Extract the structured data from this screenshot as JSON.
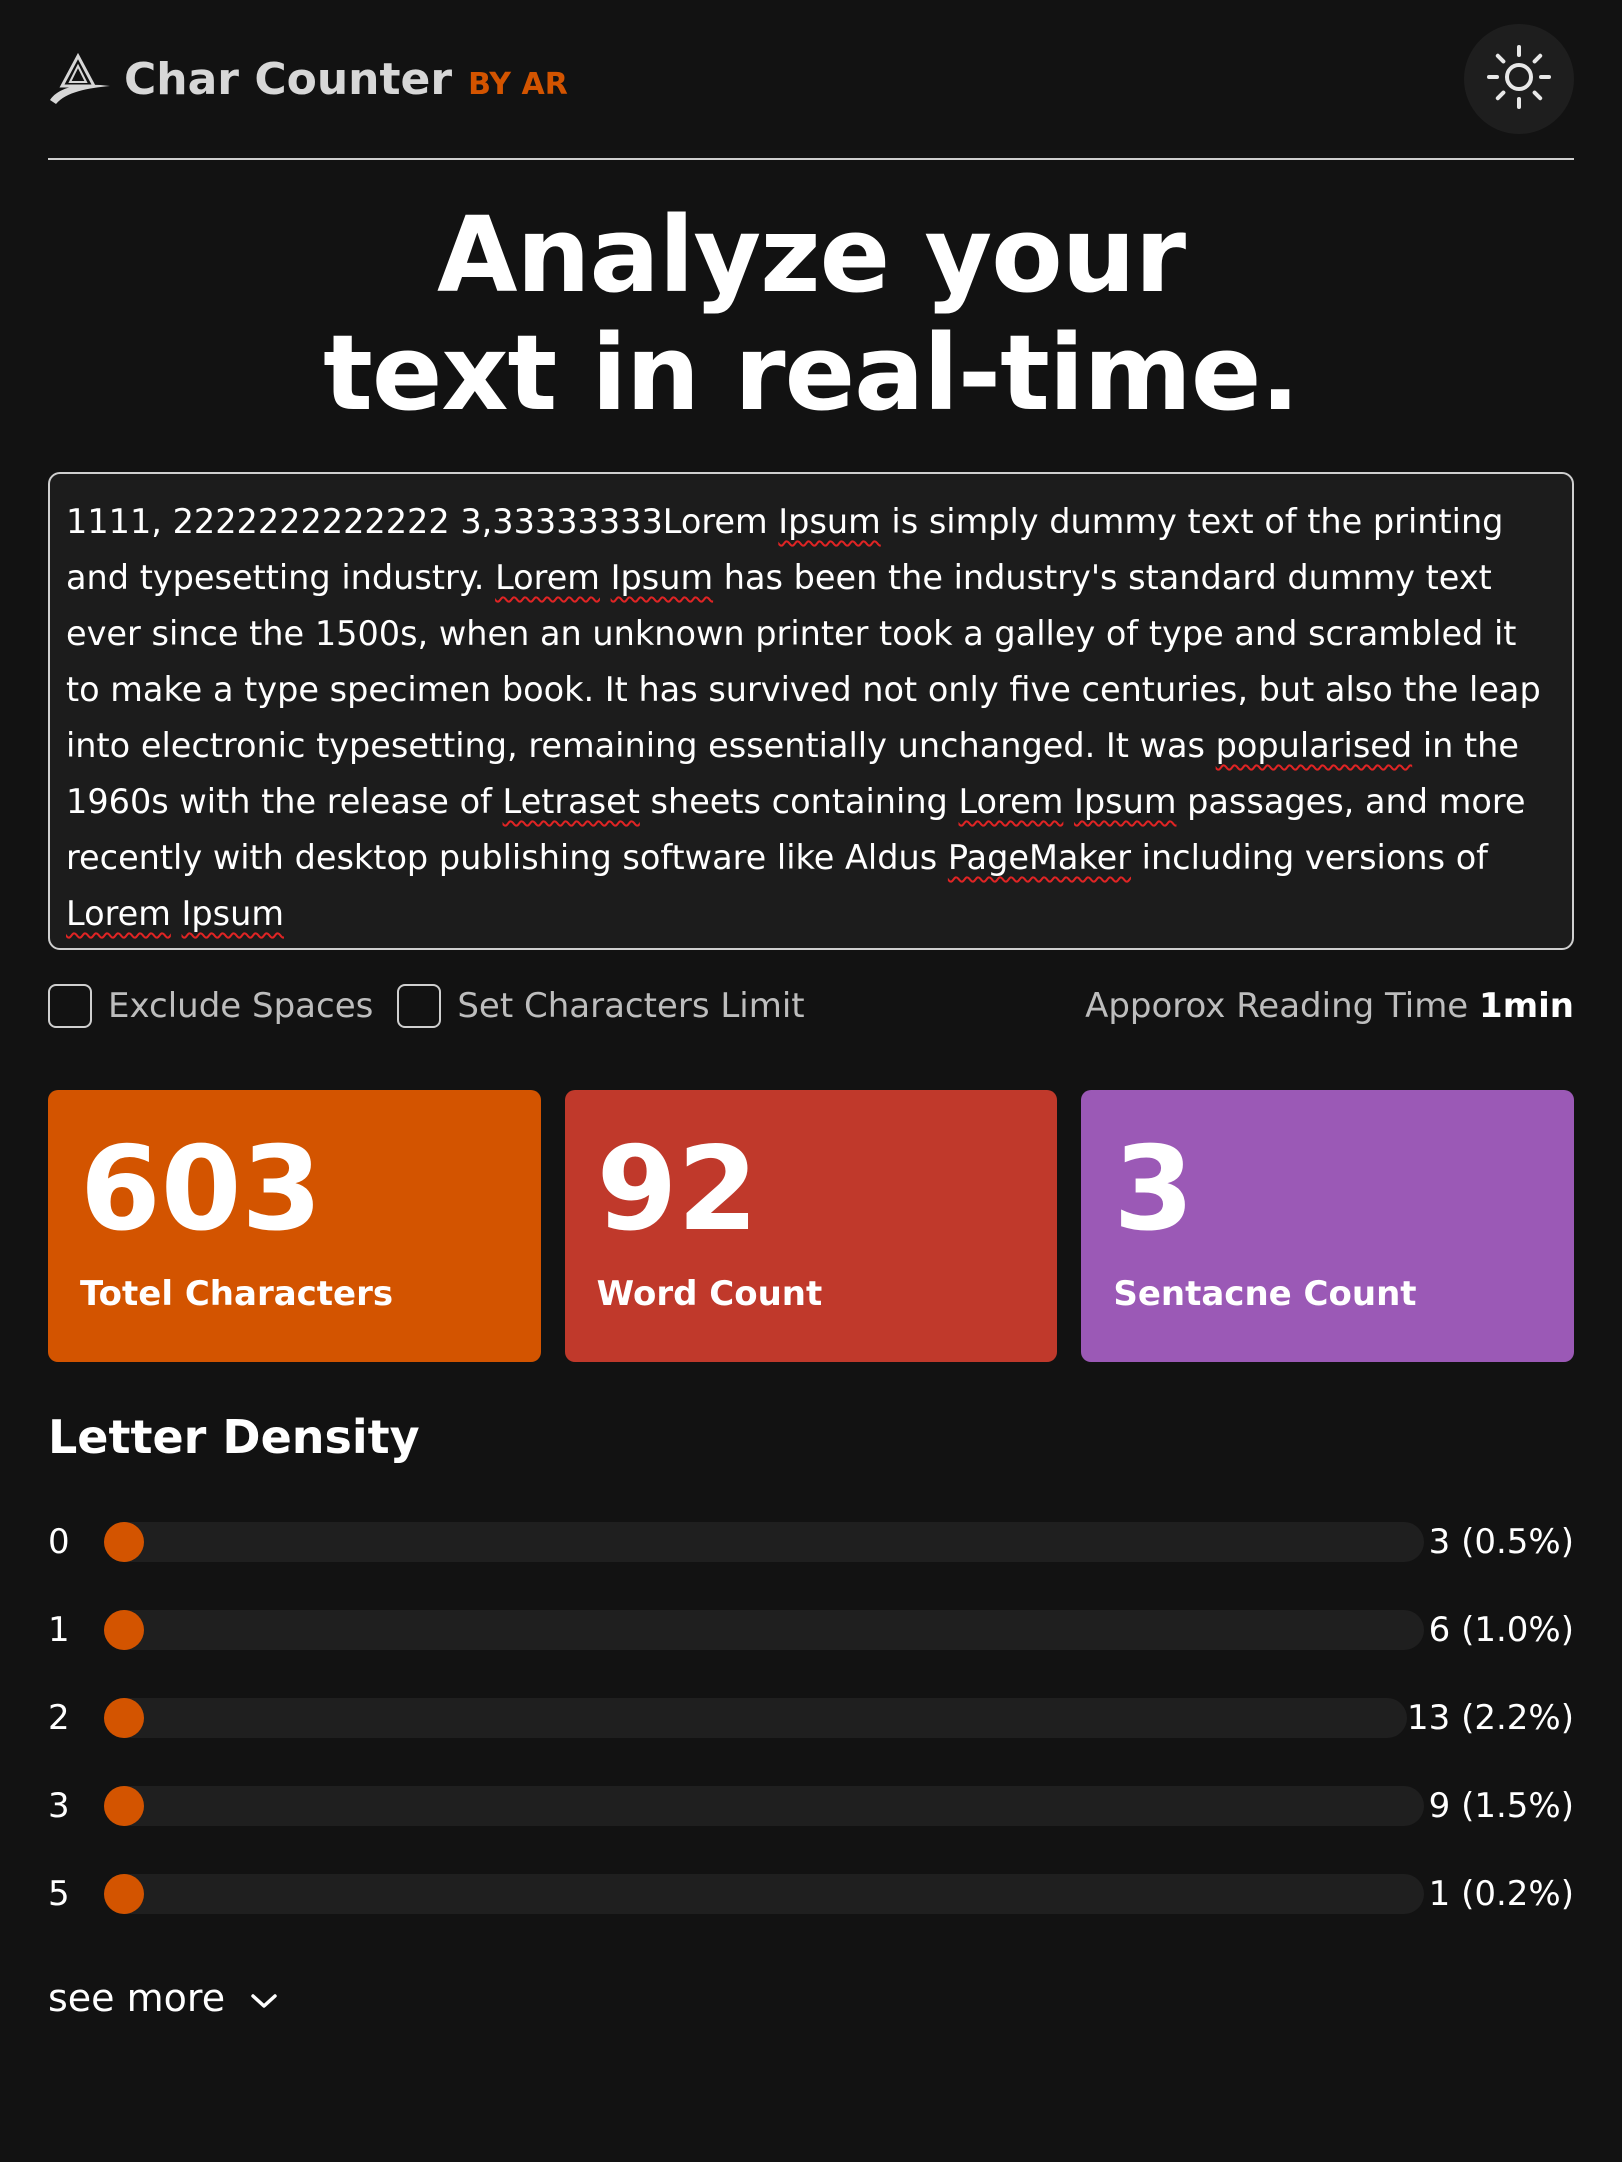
{
  "header": {
    "brand_name": "Char Counter",
    "brand_by": "BY AR",
    "logo_icon": "triangle-logo-icon",
    "theme_icon": "sun-icon"
  },
  "hero": {
    "line1": "Analyze your",
    "line2": "text in real-time."
  },
  "text_input": {
    "value": "1111, 2222222222222 3,33333333Lorem Ipsum is simply dummy text of the printing and typesetting industry. Lorem Ipsum has been the industry's standard dummy text ever since the 1500s, when an unknown printer took a galley of type and scrambled it to make a type specimen book. It has survived not only five centuries, but also the leap into electronic typesetting, remaining essentially unchanged. It was popularised in the 1960s with the release of Letraset sheets containing Lorem Ipsum passages, and more recently with desktop publishing software like Aldus PageMaker including versions of Lorem Ipsum",
    "misspelled_words": [
      "Ipsum",
      "Lorem",
      "popularised",
      "Letraset",
      "PageMaker"
    ]
  },
  "options": {
    "exclude_spaces_label": "Exclude Spaces",
    "exclude_spaces_checked": false,
    "char_limit_label": "Set Characters Limit",
    "char_limit_checked": false,
    "reading_time_label": "Apporox Reading Time",
    "reading_time_value": "1min"
  },
  "stats": [
    {
      "value": "603",
      "label": "Totel Characters",
      "color": "#d35400"
    },
    {
      "value": "92",
      "label": "Word Count",
      "color": "#c0392b"
    },
    {
      "value": "3",
      "label": "Sentacne Count",
      "color": "#9b59b6"
    }
  ],
  "density": {
    "title": "Letter Density",
    "accent": "#d35400",
    "items": [
      {
        "char": "0",
        "count": "3 (0.5%)",
        "fraction": 0.005
      },
      {
        "char": "1",
        "count": "6 (1.0%)",
        "fraction": 0.01
      },
      {
        "char": "2",
        "count": "13 (2.2%)",
        "fraction": 0.022
      },
      {
        "char": "3",
        "count": "9 (1.5%)",
        "fraction": 0.015
      },
      {
        "char": "5",
        "count": "1 (0.2%)",
        "fraction": 0.002
      }
    ],
    "see_more_label": "see more",
    "see_more_icon": "chevron-down-icon"
  }
}
